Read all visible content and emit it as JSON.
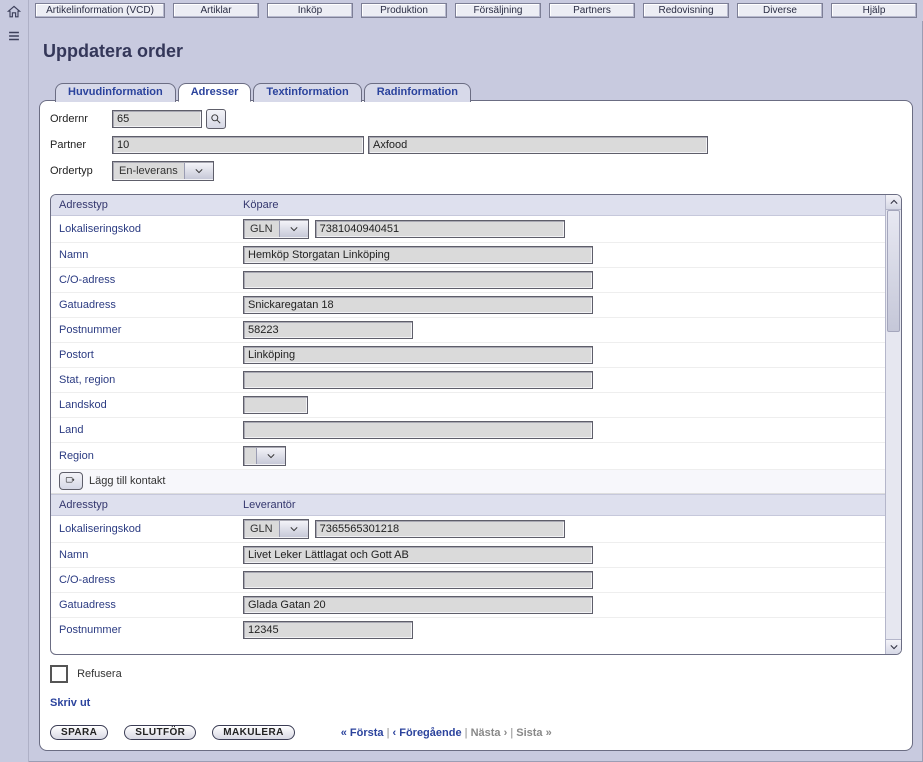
{
  "menubar": [
    "Artikelinformation (VCD)",
    "Artiklar",
    "Inköp",
    "Produktion",
    "Försäljning",
    "Partners",
    "Redovisning",
    "Diverse",
    "Hjälp"
  ],
  "page_title": "Uppdatera order",
  "tabs": [
    "Huvudinformation",
    "Adresser",
    "Textinformation",
    "Radinformation"
  ],
  "active_tab_index": 1,
  "order": {
    "ordernr_label": "Ordernr",
    "ordernr": "65",
    "partner_label": "Partner",
    "partner_id": "10",
    "partner_name": "Axfood",
    "ordertyp_label": "Ordertyp",
    "ordertyp": "En-leverans"
  },
  "section_head": {
    "label": "Adresstyp"
  },
  "buyer": {
    "title": "Köpare",
    "fields": {
      "lokkod_label": "Lokaliseringskod",
      "lokkod_type": "GLN",
      "lokkod_value": "7381040940451",
      "namn_label": "Namn",
      "namn": "Hemköp Storgatan Linköping",
      "co_label": "C/O-adress",
      "co": "",
      "gata_label": "Gatuadress",
      "gata": "Snickaregatan 18",
      "postnr_label": "Postnummer",
      "postnr": "58223",
      "postort_label": "Postort",
      "postort": "Linköping",
      "stat_label": "Stat, region",
      "stat": "",
      "landskod_label": "Landskod",
      "landskod": "",
      "land_label": "Land",
      "land": "",
      "region_label": "Region",
      "region": ""
    }
  },
  "add_contact_label": "Lägg till kontakt",
  "supplier": {
    "title": "Leverantör",
    "fields": {
      "lokkod_label": "Lokaliseringskod",
      "lokkod_type": "GLN",
      "lokkod_value": "7365565301218",
      "namn_label": "Namn",
      "namn": "Livet Leker Lättlagat och Gott AB",
      "co_label": "C/O-adress",
      "co": "",
      "gata_label": "Gatuadress",
      "gata": "Glada Gatan 20",
      "postnr_label": "Postnummer",
      "postnr": "12345"
    }
  },
  "footer": {
    "refusera_label": "Refusera",
    "print_label": "Skriv ut",
    "spara": "SPARA",
    "slutfor": "SLUTFÖR",
    "makulera": "MAKULERA",
    "pager": {
      "first": "« Första",
      "prev": "‹ Föregående",
      "next": "Nästa ›",
      "last": "Sista »"
    }
  }
}
